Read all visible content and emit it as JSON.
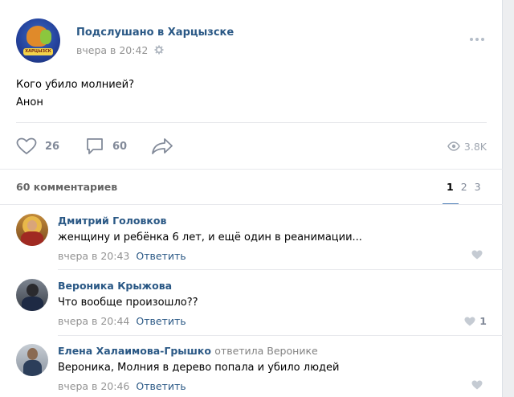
{
  "post": {
    "group_name": "Подслушано в Харцызске",
    "time": "вчера в 20:42",
    "text_line1": "Кого убило молнией?",
    "text_line2": "Анон",
    "likes": "26",
    "comments": "60",
    "views": "3.8K"
  },
  "comments_section": {
    "count_label": "60 комментариев",
    "pages": [
      "1",
      "2",
      "3"
    ],
    "active_page": "1"
  },
  "comments": [
    {
      "author": "Дмитрий Головков",
      "reply_note": "",
      "text": "женщину и ребёнка 6 лет, и ещё один в реанимации...",
      "time": "вчера в 20:43",
      "reply_label": "Ответить",
      "likes": ""
    },
    {
      "author": "Вероника Крыжова",
      "reply_note": "",
      "text": "Что вообще произошло??",
      "time": "вчера в 20:44",
      "reply_label": "Ответить",
      "likes": "1"
    },
    {
      "author": "Елена Халаимова-Грышко",
      "reply_note": "ответила Веронике",
      "text": "Вероника, Молния в дерево попала и убило людей",
      "time": "вчера в 20:46",
      "reply_label": "Ответить",
      "likes": ""
    }
  ],
  "icons": {
    "like": "heart-icon",
    "comment": "comment-bubble-icon",
    "share": "share-arrow-icon",
    "views": "eye-icon",
    "settings": "gear-icon",
    "more": "more-dots-icon"
  },
  "colors": {
    "link": "#2a5885",
    "muted": "#939393",
    "icon": "#828a99",
    "accent": "#5181b8"
  }
}
